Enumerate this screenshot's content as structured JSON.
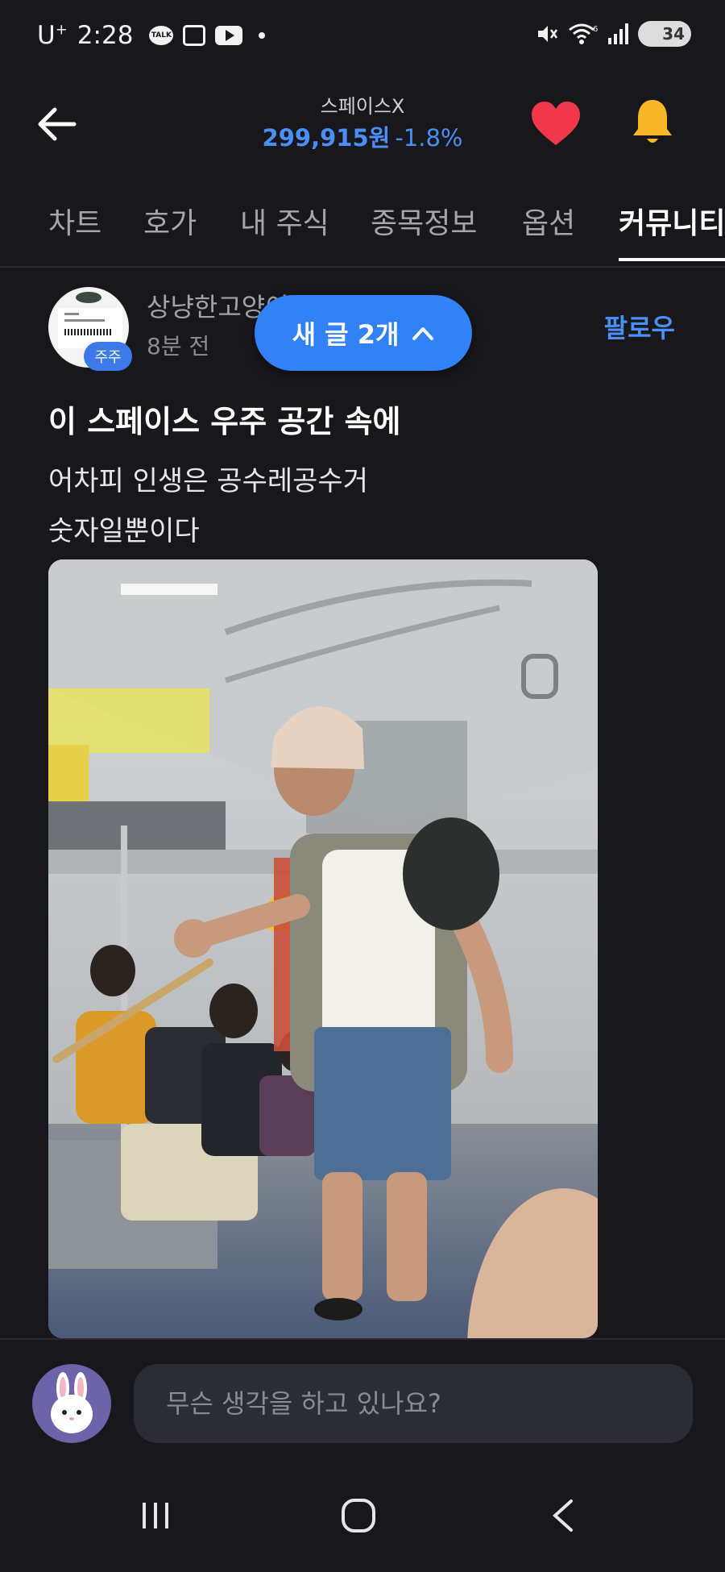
{
  "status_bar": {
    "carrier": "U",
    "carrier_sup": "+",
    "time": "2:28",
    "talk_label": "TALK",
    "battery": "34",
    "icons": [
      "talk-icon",
      "scan-icon",
      "youtube-icon",
      "dot-icon",
      "mute-icon",
      "wifi-icon",
      "signal-icon",
      "battery-icon"
    ]
  },
  "header": {
    "stock_name": "스페이스X",
    "price": "299,915원",
    "change": "-1.8%",
    "price_color": "#4a8ff5",
    "icons": [
      "back-arrow-icon",
      "heart-icon",
      "bell-icon"
    ],
    "heart_color": "#f0384a",
    "bell_color": "#f7b726"
  },
  "tabs": [
    {
      "label": "차트"
    },
    {
      "label": "호가"
    },
    {
      "label": "내 주식"
    },
    {
      "label": "종목정보"
    },
    {
      "label": "옵션"
    },
    {
      "label": "커뮤니티",
      "active": true
    }
  ],
  "post": {
    "author": "상냥한고양이 ○○",
    "time": "8분 전",
    "badge": "주주",
    "follow_label": "팔로우",
    "new_posts_label": "새 글 2개",
    "title": "이 스페이스 우주 공간 속에",
    "body_line1": "어차피 인생은 공수레공수거",
    "body_line2": "숫자일뿐이다"
  },
  "comment": {
    "placeholder": "무슨 생각을 하고 있나요?"
  },
  "navbar": {
    "icons": [
      "recent-apps-icon",
      "home-icon",
      "back-icon"
    ]
  },
  "colors": {
    "background": "#17171c",
    "accent": "#3182f6"
  }
}
